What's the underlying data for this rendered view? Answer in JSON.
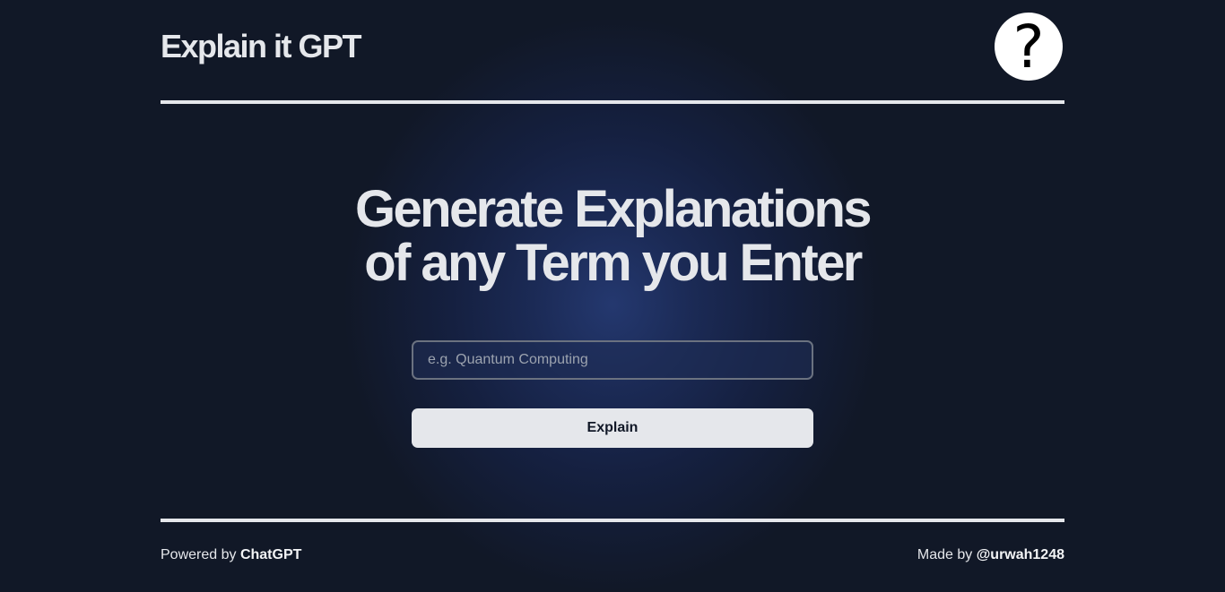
{
  "header": {
    "brand": "Explain it GPT",
    "help_glyph": "?",
    "help_icon": "question-mark-icon"
  },
  "main": {
    "headline_line1": "Generate Explanations",
    "headline_line2": "of any Term you Enter",
    "input_placeholder": "e.g. Quantum Computing",
    "input_value": "",
    "button_label": "Explain"
  },
  "footer": {
    "powered_prefix": "Powered by ",
    "powered_link": "ChatGPT",
    "made_prefix": "Made by ",
    "made_link": "@urwah1248"
  },
  "colors": {
    "background": "#111827",
    "glow": "#24386f",
    "text": "#e5e7eb",
    "button_bg": "#e5e7eb"
  }
}
